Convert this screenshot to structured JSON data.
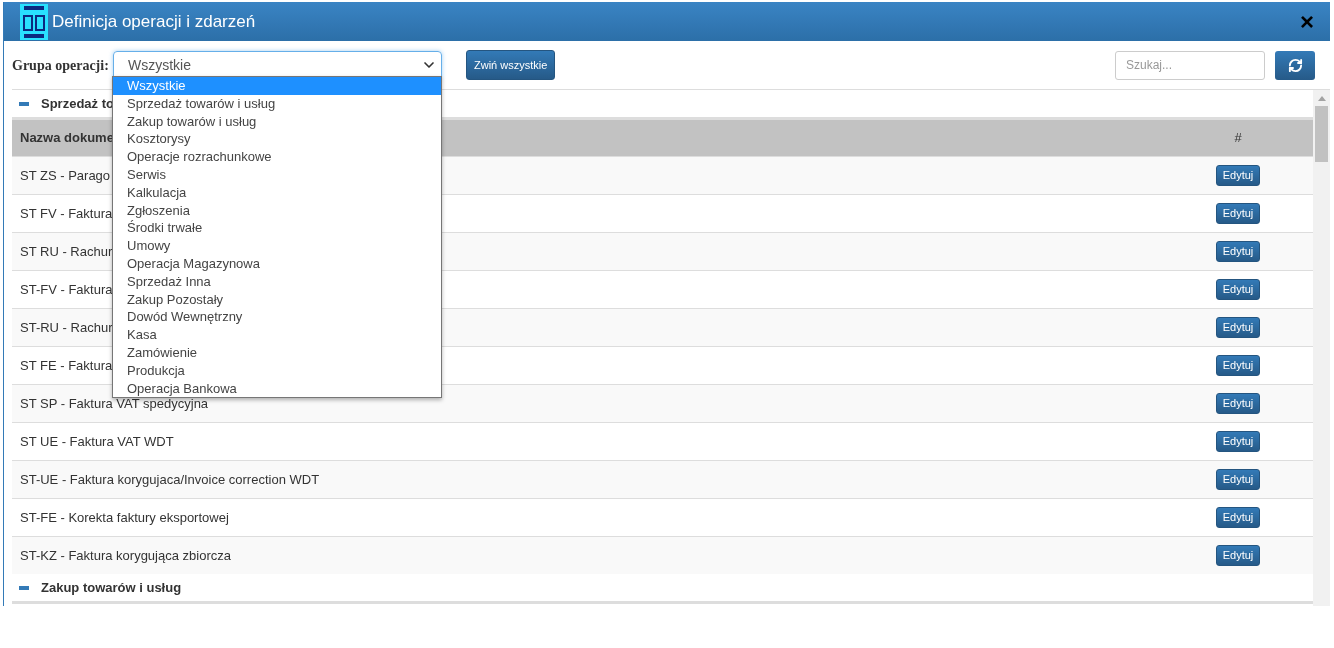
{
  "window": {
    "title": "Definicja operacji i zdarzeń",
    "close": "×"
  },
  "toolbar": {
    "group_label": "Grupa operacji:",
    "group_value": "Wszystkie",
    "collapse_button": "Zwiń wszystkie",
    "search": {
      "placeholder": "Szukaj..."
    }
  },
  "dropdown": {
    "options": [
      {
        "label": "Wszystkie",
        "selected": true
      },
      {
        "label": "Sprzedaż towarów i usług",
        "selected": false
      },
      {
        "label": "Zakup towarów i usług",
        "selected": false
      },
      {
        "label": "Kosztorysy",
        "selected": false
      },
      {
        "label": "Operacje rozrachunkowe",
        "selected": false
      },
      {
        "label": "Serwis",
        "selected": false
      },
      {
        "label": "Kalkulacja",
        "selected": false
      },
      {
        "label": "Zgłoszenia",
        "selected": false
      },
      {
        "label": "Środki trwałe",
        "selected": false
      },
      {
        "label": "Umowy",
        "selected": false
      },
      {
        "label": "Operacja Magazynowa",
        "selected": false
      },
      {
        "label": "Sprzedaż Inna",
        "selected": false
      },
      {
        "label": "Zakup Pozostały",
        "selected": false
      },
      {
        "label": "Dowód Wewnętrzny",
        "selected": false
      },
      {
        "label": "Kasa",
        "selected": false
      },
      {
        "label": "Zamówienie",
        "selected": false
      },
      {
        "label": "Produkcja",
        "selected": false
      },
      {
        "label": "Operacja Bankowa",
        "selected": false
      }
    ]
  },
  "sections": [
    {
      "title": "Sprzedaż to",
      "expanded": true,
      "columns": [
        "Nazwa dokume",
        "#"
      ],
      "rows": [
        {
          "name": "ST ZS - Parago",
          "action": "Edytuj"
        },
        {
          "name": "ST FV - Faktura",
          "action": "Edytuj"
        },
        {
          "name": "ST RU - Rachur",
          "action": "Edytuj"
        },
        {
          "name": "ST-FV - Faktura",
          "action": "Edytuj"
        },
        {
          "name": "ST-RU - Rachur",
          "action": "Edytuj"
        },
        {
          "name": "ST FE - Faktura",
          "action": "Edytuj"
        },
        {
          "name": "ST SP - Faktura VAT spedycyjna",
          "action": "Edytuj"
        },
        {
          "name": "ST UE - Faktura VAT WDT",
          "action": "Edytuj"
        },
        {
          "name": "ST-UE - Faktura korygujaca/Invoice correction WDT",
          "action": "Edytuj"
        },
        {
          "name": "ST-FE - Korekta faktury eksportowej",
          "action": "Edytuj"
        },
        {
          "name": "ST-KZ - Faktura korygująca zbiorcza",
          "action": "Edytuj"
        }
      ]
    },
    {
      "title": "Zakup towarów i usług",
      "expanded": true
    }
  ]
}
